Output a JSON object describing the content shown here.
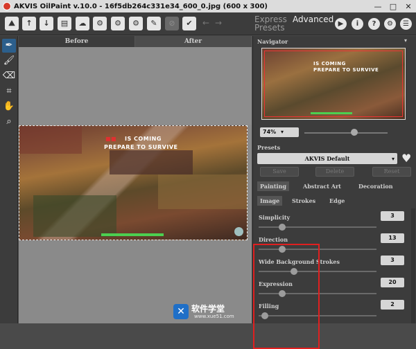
{
  "window": {
    "title": "AKVIS OilPaint v.10.0 - 16f5db264c331e34_600_0.jpg (600 x 300)",
    "controls": [
      "—",
      "□",
      "✕"
    ]
  },
  "toolbar": {
    "mode_tabs": [
      "Express\nPresets",
      "Advanced"
    ],
    "mode_express_line1": "Express",
    "mode_express_line2": "Presets",
    "mode_advanced": "Advanced",
    "icons": [
      "open-image-icon",
      "open-file-icon",
      "save-icon",
      "print-icon",
      "export-icon",
      "batch-icon",
      "plugin-icon",
      "settings-icon",
      "brush-icon",
      "disabled-icon",
      "share-icon"
    ],
    "round_icons": [
      "run-icon",
      "info-icon",
      "help-icon",
      "gear-icon",
      "notifications-icon"
    ]
  },
  "canvas": {
    "before_label": "Before",
    "after_label": "After",
    "image_text_line1": "IS COMING",
    "image_text_line2": "PREPARE TO SURVIVE"
  },
  "navigator": {
    "title": "Navigator",
    "thumb_text_line1": "IS COMING",
    "thumb_text_line2": "PREPARE TO SURVIVE",
    "zoom": "74%"
  },
  "presets": {
    "title": "Presets",
    "selected": "AKVIS Default",
    "save_label": "Save",
    "delete_label": "Delete",
    "reset_label": "Reset"
  },
  "categories": {
    "tabs": [
      "Painting",
      "Abstract Art",
      "Decoration"
    ],
    "active": "Painting"
  },
  "subtabs": {
    "tabs": [
      "Image",
      "Strokes",
      "Edge"
    ],
    "active": "Image"
  },
  "params": [
    {
      "label": "Simplicity",
      "value": "3",
      "level": 0.2
    },
    {
      "label": "Direction",
      "value": "13",
      "level": 0.2
    },
    {
      "label": "Wide Background Strokes",
      "value": "3",
      "level": 0.3
    },
    {
      "label": "Expression",
      "value": "20",
      "level": 0.2
    },
    {
      "label": "Filling",
      "value": "2",
      "level": 0.05
    }
  ],
  "watermark": {
    "cn": "软件学堂",
    "url": "www.xue51.com"
  },
  "colors": {
    "accent": "#2c5f8c",
    "highlight": "#e02020"
  }
}
